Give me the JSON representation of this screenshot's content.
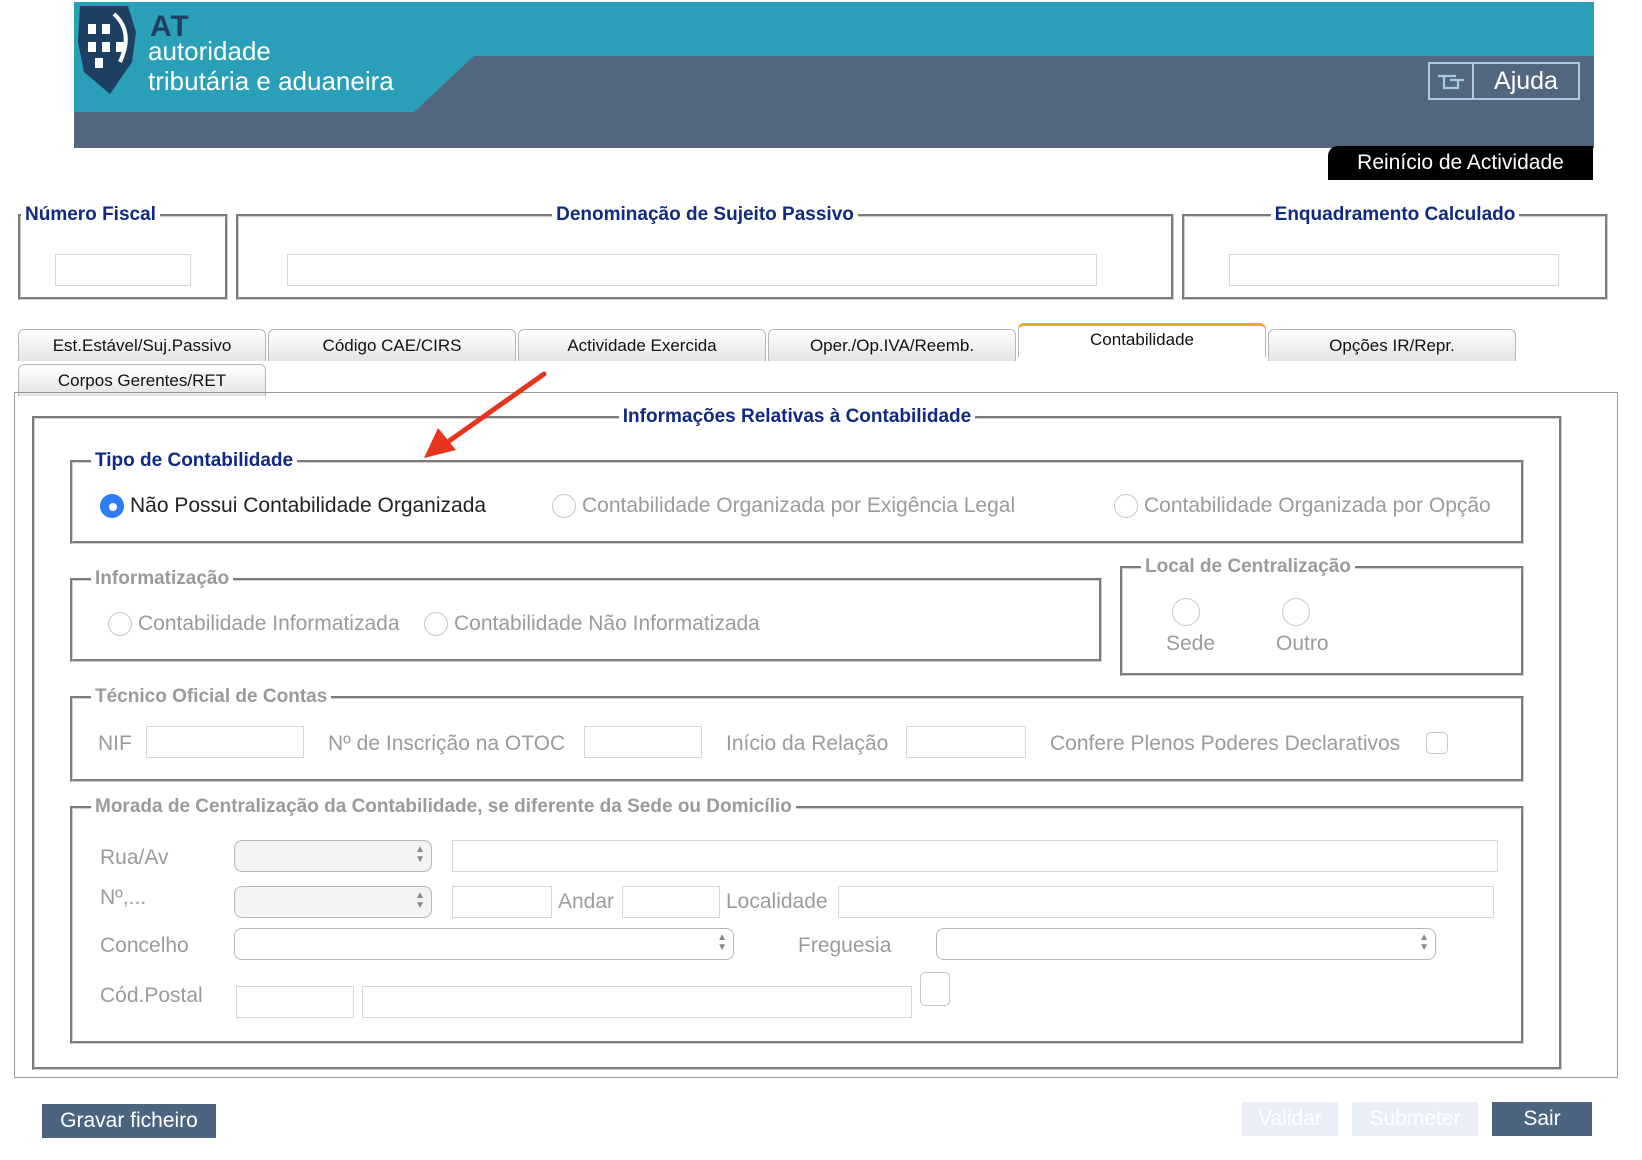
{
  "header": {
    "logo_at": "AT",
    "logo_line1": "autoridade",
    "logo_line2": "tributária e aduaneira",
    "help_label": "Ajuda",
    "section_badge": "Reinício de Actividade"
  },
  "identification": {
    "nif_legend": "Número Fiscal",
    "name_legend": "Denominação de Sujeito Passivo",
    "framework_legend": "Enquadramento Calculado"
  },
  "tabs": [
    {
      "label": "Est.Estável/Suj.Passivo",
      "active": false
    },
    {
      "label": "Código CAE/CIRS",
      "active": false
    },
    {
      "label": "Actividade Exercida",
      "active": false
    },
    {
      "label": "Oper./Op.IVA/Reemb.",
      "active": false
    },
    {
      "label": "Contabilidade",
      "active": true
    },
    {
      "label": "Opções IR/Repr.",
      "active": false
    },
    {
      "label": "Corpos Gerentes/RET",
      "active": false
    }
  ],
  "main": {
    "legend": "Informações Relativas à Contabilidade",
    "tipo": {
      "legend": "Tipo de Contabilidade",
      "options": [
        {
          "label": "Não Possui Contabilidade Organizada",
          "selected": true
        },
        {
          "label": "Contabilidade Organizada por Exigência Legal",
          "selected": false
        },
        {
          "label": "Contabilidade Organizada por Opção",
          "selected": false
        }
      ]
    },
    "informatizacao": {
      "legend": "Informatização",
      "options": [
        {
          "label": "Contabilidade Informatizada"
        },
        {
          "label": "Contabilidade Não Informatizada"
        }
      ]
    },
    "centralizacao": {
      "legend": "Local de Centralização",
      "options": [
        {
          "label": "Sede"
        },
        {
          "label": "Outro"
        }
      ]
    },
    "toc": {
      "legend": "Técnico Oficial de Contas",
      "nif_label": "NIF",
      "otoc_label": "Nº de Inscrição na OTOC",
      "inicio_label": "Início da Relação",
      "poderes_label": "Confere Plenos Poderes Declarativos"
    },
    "morada": {
      "legend": "Morada de Centralização da Contabilidade, se diferente da Sede ou Domicílio",
      "rua_label": "Rua/Av",
      "numero_label": "Nº,...",
      "andar_label": "Andar",
      "localidade_label": "Localidade",
      "concelho_label": "Concelho",
      "freguesia_label": "Freguesia",
      "codpostal_label": "Cód.Postal"
    }
  },
  "footer": {
    "save_label": "Gravar ficheiro",
    "validate_label": "Validar",
    "submit_label": "Submeter",
    "exit_label": "Sair"
  },
  "colors": {
    "header_teal": "#2aa0b8",
    "header_slate": "#52677f",
    "legend_blue": "#0f2a80",
    "active_tab_accent": "#f2a521",
    "radio_selected": "#2f7df6",
    "annotation_arrow": "#e8341c"
  }
}
